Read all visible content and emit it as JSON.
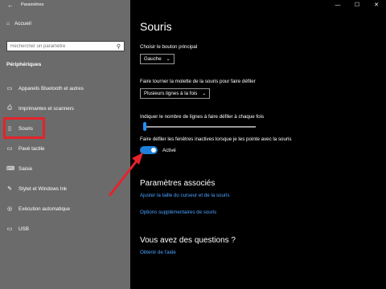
{
  "window": {
    "title": "Paramètres",
    "controls": [
      "—",
      "☐",
      "✕"
    ]
  },
  "sidebar": {
    "home": "Accueil",
    "search_placeholder": "Rechercher un paramètre",
    "section": "Périphériques",
    "items": [
      {
        "label": "Appareils Bluetooth et autres",
        "icon": "bluetooth-icon"
      },
      {
        "label": "Imprimantes et scanners",
        "icon": "printer-icon"
      },
      {
        "label": "Souris",
        "icon": "mouse-icon"
      },
      {
        "label": "Pavé tactile",
        "icon": "touchpad-icon"
      },
      {
        "label": "Saisie",
        "icon": "keyboard-icon"
      },
      {
        "label": "Stylet et Windows Ink",
        "icon": "pen-icon"
      },
      {
        "label": "Exécution automatique",
        "icon": "autoplay-icon"
      },
      {
        "label": "USB",
        "icon": "usb-icon"
      }
    ]
  },
  "main": {
    "title": "Souris",
    "primary_button": {
      "label": "Choisir le bouton principal",
      "value": "Gauche"
    },
    "scroll_wheel": {
      "label": "Faire tourner la molette de la souris pour faire défiler",
      "value": "Plusieurs lignes à la fois"
    },
    "lines_slider": {
      "label": "Indiquer le nombre de lignes à faire défiler à chaque fois",
      "level": 0.0
    },
    "inactive_scroll": {
      "label": "Faire défiler les fenêtres inactives lorsque je les pointe avec la souris",
      "state": "Activé"
    },
    "related": {
      "heading": "Paramètres associés",
      "links": [
        "Ajuster la taille du curseur et de la souris",
        "Options supplémentaires de souris"
      ]
    },
    "questions": {
      "heading": "Vous avez des questions ?",
      "link": "Obtenir de l'aide"
    }
  },
  "colors": {
    "sidebar_bg": "#6b6b6b",
    "accent": "#1e90ff",
    "highlight": "#e5232b"
  }
}
